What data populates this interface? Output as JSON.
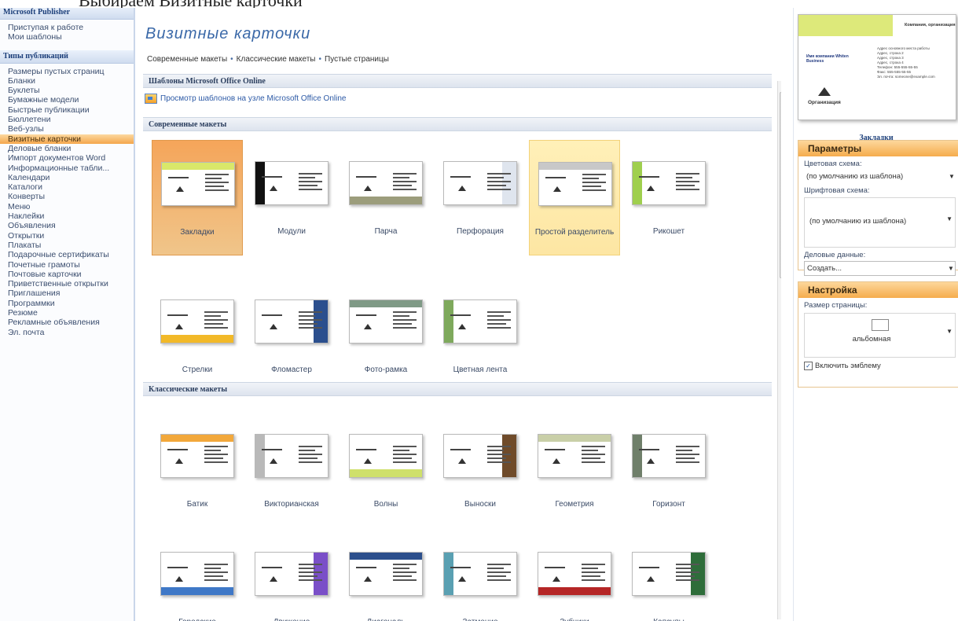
{
  "doc_top": {
    "prefix": "Выбираем ",
    "link": "Визитные карточки"
  },
  "sidebar": {
    "app_header": "Microsoft Publisher",
    "top_items": [
      "Приступая к работе",
      "Мои шаблоны"
    ],
    "types_header": "Типы публикаций",
    "items": [
      "Размеры пустых страниц",
      "Бланки",
      "Буклеты",
      "Бумажные модели",
      "Быстрые публикации",
      "Бюллетени",
      "Веб-узлы",
      "Визитные карточки",
      "Деловые бланки",
      "Импорт документов Word",
      "Информационные табли...",
      "Календари",
      "Каталоги",
      "Конверты",
      "Меню",
      "Наклейки",
      "Объявления",
      "Открытки",
      "Плакаты",
      "Подарочные сертификаты",
      "Почетные грамоты",
      "Почтовые карточки",
      "Приветственные открытки",
      "Приглашения",
      "Программки",
      "Резюме",
      "Рекламные объявления",
      "Эл. почта"
    ],
    "active_index": 7
  },
  "main": {
    "title": "Визитные карточки",
    "nav": [
      "Современные макеты",
      "Классические макеты",
      "Пустые страницы"
    ],
    "online_section": "Шаблоны Microsoft Office Online",
    "online_link": "Просмотр шаблонов на узле Microsoft Office Online",
    "modern_section": "Современные макеты",
    "classic_section": "Классические макеты",
    "modern_cards": [
      {
        "label": "Закладки",
        "state": "selected",
        "accent": "#d9e86a"
      },
      {
        "label": "Модули",
        "state": "",
        "accent": "#111111"
      },
      {
        "label": "Парча",
        "state": "",
        "accent": "#9c9d7c"
      },
      {
        "label": "Перфорация",
        "state": "",
        "accent": "#dfe5ee"
      },
      {
        "label": "Простой разделитель",
        "state": "hover",
        "accent": "#c8c8c8"
      },
      {
        "label": "Рикошет",
        "state": "",
        "accent": "#9fcf4e"
      },
      {
        "label": "Стрелки",
        "state": "",
        "accent": "#f2b928"
      },
      {
        "label": "Фломастер",
        "state": "",
        "accent": "#2b4f8e"
      },
      {
        "label": "Фото-рамка",
        "state": "",
        "accent": "#7f9a86"
      },
      {
        "label": "Цветная лента",
        "state": "",
        "accent": "#7ea95c"
      }
    ],
    "classic_cards": [
      {
        "label": "Батик",
        "accent": "#f2a83b"
      },
      {
        "label": "Викторианская",
        "accent": "#b9b9b9"
      },
      {
        "label": "Волны",
        "accent": "#cfe06b"
      },
      {
        "label": "Выноски",
        "accent": "#6f4b2a"
      },
      {
        "label": "Геометрия",
        "accent": "#c9cfa8"
      },
      {
        "label": "Горизонт",
        "accent": "#6f7f6a"
      },
      {
        "label": "Городские",
        "accent": "#3f78c7"
      },
      {
        "label": "Движение",
        "accent": "#7a4fc8"
      },
      {
        "label": "Диагональ",
        "accent": "#2c4f8c"
      },
      {
        "label": "Затмение",
        "accent": "#5aa0b2"
      },
      {
        "label": "Зубчики",
        "accent": "#b52626"
      },
      {
        "label": "Капсулы",
        "accent": "#2e6d3a"
      }
    ]
  },
  "preview": {
    "org": "Компания, организация",
    "person": "Имя компании Whiten Business",
    "info": [
      "Адрес основного места работы",
      "Адрес, строка 2",
      "Адрес, строка 3",
      "Адрес, строка 4",
      "Телефон: 555-555-55-55",
      "Факс: 555-555-55-55",
      "Эл. почта: someone@example.com"
    ],
    "logo_text": "Организация",
    "caption": "Закладки"
  },
  "params": {
    "title": "Параметры",
    "color_scheme_label": "Цветовая схема:",
    "color_scheme_value": "(по умолчанию из шаблона)",
    "font_scheme_label": "Шрифтовая схема:",
    "font_scheme_value": "(по умолчанию из шаблона)",
    "business_label": "Деловые данные:",
    "business_value": "Создать..."
  },
  "setup": {
    "title": "Настройка",
    "page_size_label": "Размер страницы:",
    "page_size_value": "альбомная",
    "logo_checkbox": "Включить эмблему",
    "logo_checked": true
  }
}
